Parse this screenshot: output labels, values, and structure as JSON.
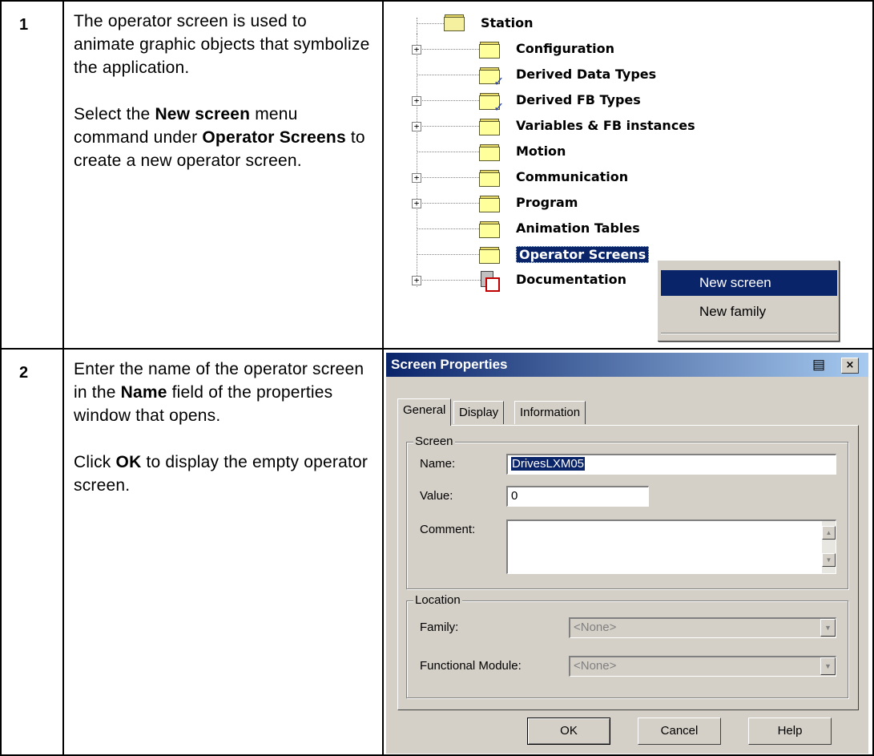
{
  "steps": [
    {
      "number": "1",
      "paragraphs": [
        [
          "The operator screen is used to animate graphic objects that symbolize the application."
        ],
        [
          "Select the ",
          {
            "b": "New screen"
          },
          " menu command under ",
          {
            "b": "Operator Screens"
          },
          " to create a new operator screen."
        ]
      ]
    },
    {
      "number": "2",
      "paragraphs": [
        [
          "Enter the name of the operator screen in the ",
          {
            "b": "Name"
          },
          " field of the properties window that opens."
        ],
        [
          "Click ",
          {
            "b": "OK"
          },
          " to display the empty operator screen."
        ]
      ]
    }
  ],
  "tree": {
    "root": "Station",
    "items": [
      {
        "label": "Configuration",
        "expander": "+",
        "icon": "folder-icon"
      },
      {
        "label": "Derived Data Types",
        "expander": "",
        "icon": "folder-check-icon"
      },
      {
        "label": "Derived FB Types",
        "expander": "+",
        "icon": "folder-check-icon"
      },
      {
        "label": "Variables & FB instances",
        "expander": "+",
        "icon": "folder-icon"
      },
      {
        "label": "Motion",
        "expander": "",
        "icon": "folder-icon"
      },
      {
        "label": "Communication",
        "expander": "+",
        "icon": "folder-icon"
      },
      {
        "label": "Program",
        "expander": "+",
        "icon": "folder-icon"
      },
      {
        "label": "Animation Tables",
        "expander": "",
        "icon": "folder-icon"
      },
      {
        "label": "Operator Screens",
        "expander": "",
        "icon": "folder-icon",
        "selected": true
      },
      {
        "label": "Documentation",
        "expander": "+",
        "icon": "documentation-icon"
      }
    ]
  },
  "context_menu": {
    "items": [
      "New screen",
      "New family"
    ],
    "highlighted": "New screen"
  },
  "dialog": {
    "title": "Screen Properties",
    "print_icon": "▤",
    "close_icon": "×",
    "tabs": [
      "General",
      "Display",
      "Information"
    ],
    "active_tab": "General",
    "screen_group": "Screen",
    "name_label": "Name:",
    "name_value": "DrivesLXM05",
    "value_label": "Value:",
    "value_value": "0",
    "comment_label": "Comment:",
    "comment_value": "",
    "location_group": "Location",
    "family_label": "Family:",
    "family_value": "<None>",
    "module_label": "Functional Module:",
    "module_value": "<None>",
    "ok_label": "OK",
    "cancel_label": "Cancel",
    "help_label": "Help"
  }
}
